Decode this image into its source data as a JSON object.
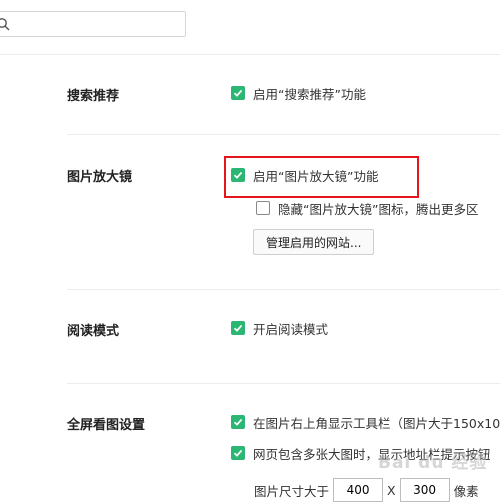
{
  "search": {
    "placeholder": ""
  },
  "sections": {
    "search_recommend": {
      "title": "搜索推荐",
      "option": "启用“搜索推荐”功能"
    },
    "image_magnifier": {
      "title": "图片放大镜",
      "option_enable": "启用“图片放大镜”功能",
      "option_hide": "隐藏“图片放大镜”图标，腾出更多区",
      "manage_button": "管理启用的网站..."
    },
    "reading_mode": {
      "title": "阅读模式",
      "option": "开启阅读模式"
    },
    "fullscreen_image": {
      "title": "全屏看图设置",
      "option_toolbar": "在图片右上角显示工具栏（图片大于150x10",
      "option_multi": "网页包含多张大图时，显示地址栏提示按钮",
      "size_label": "图片尺寸大于",
      "width_value": "400",
      "x_sep": "X",
      "height_value": "300",
      "unit": "像素"
    }
  },
  "watermark": "Bai du 经验",
  "colors": {
    "checkbox_on": "#2bb673",
    "highlight": "#e4161d"
  }
}
